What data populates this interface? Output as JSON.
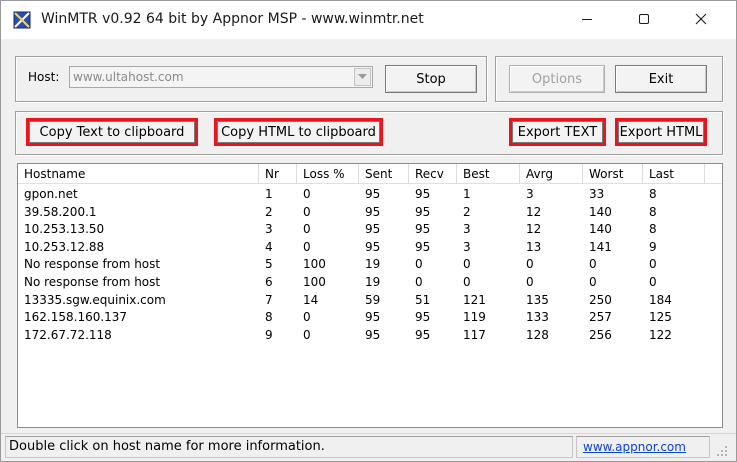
{
  "window": {
    "title": "WinMTR v0.92 64 bit by Appnor MSP - www.winmtr.net",
    "icon": "winmtr-app-icon",
    "controls": [
      "minimize-icon",
      "maximize-icon",
      "close-icon"
    ]
  },
  "host_group": {
    "label": "Host:",
    "value": "www.ultahost.com",
    "stop_label": "Stop"
  },
  "control_group": {
    "options_label": "Options",
    "exit_label": "Exit"
  },
  "export_group": {
    "copy_text_label": "Copy Text to clipboard",
    "copy_html_label": "Copy HTML to clipboard",
    "export_text_label": "Export TEXT",
    "export_html_label": "Export HTML",
    "highlight_color": "#e8161c"
  },
  "table": {
    "columns": [
      "Hostname",
      "Nr",
      "Loss %",
      "Sent",
      "Recv",
      "Best",
      "Avrg",
      "Worst",
      "Last"
    ],
    "rows": [
      [
        "gpon.net",
        "1",
        "0",
        "95",
        "95",
        "1",
        "3",
        "33",
        "8"
      ],
      [
        "39.58.200.1",
        "2",
        "0",
        "95",
        "95",
        "2",
        "12",
        "140",
        "8"
      ],
      [
        "10.253.13.50",
        "3",
        "0",
        "95",
        "95",
        "3",
        "12",
        "140",
        "8"
      ],
      [
        "10.253.12.88",
        "4",
        "0",
        "95",
        "95",
        "3",
        "13",
        "141",
        "9"
      ],
      [
        "No response from host",
        "5",
        "100",
        "19",
        "0",
        "0",
        "0",
        "0",
        "0"
      ],
      [
        "No response from host",
        "6",
        "100",
        "19",
        "0",
        "0",
        "0",
        "0",
        "0"
      ],
      [
        "13335.sgw.equinix.com",
        "7",
        "14",
        "59",
        "51",
        "121",
        "135",
        "250",
        "184"
      ],
      [
        "162.158.160.137",
        "8",
        "0",
        "95",
        "95",
        "119",
        "133",
        "257",
        "125"
      ],
      [
        "172.67.72.118",
        "9",
        "0",
        "95",
        "95",
        "117",
        "128",
        "256",
        "122"
      ]
    ]
  },
  "statusbar": {
    "message": "Double click on host name for more information.",
    "link": "www.appnor.com",
    "link_color": "#0a44d8"
  }
}
